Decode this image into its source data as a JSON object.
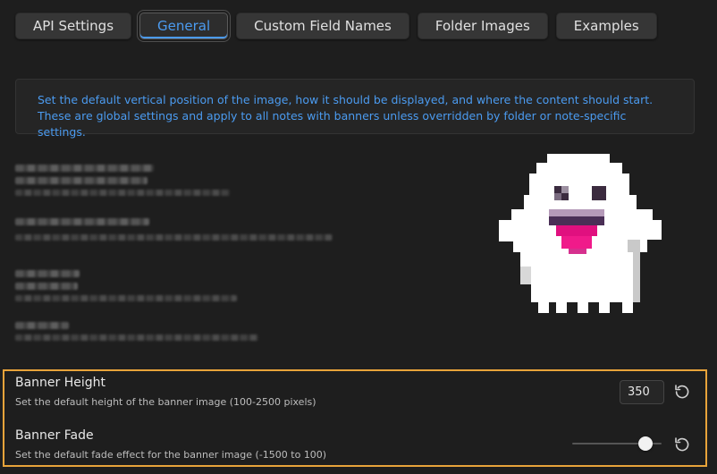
{
  "tabs": [
    {
      "label": "API Settings",
      "active": false
    },
    {
      "label": "General",
      "active": true
    },
    {
      "label": "Custom Field Names",
      "active": false
    },
    {
      "label": "Folder Images",
      "active": false
    },
    {
      "label": "Examples",
      "active": false
    }
  ],
  "info_text": "Set the default vertical position of the image, how it should be displayed, and where the content should start. These are global settings and apply to all notes with banners unless overridden by folder or note-specific settings.",
  "settings": {
    "banner_height": {
      "name": "Banner Height",
      "description": "Set the default height of the banner image (100-2500 pixels)",
      "value": "350"
    },
    "banner_fade": {
      "name": "Banner Fade",
      "description": "Set the default fade effect for the banner image (-1500 to 100)",
      "value": 100,
      "min": -1500,
      "max": 100
    }
  },
  "icons": {
    "reset": "reset-icon",
    "mascot": "ghost-icon"
  },
  "colors": {
    "accent": "#4b9bf0",
    "highlight": "#e8a33a",
    "background": "#1e1e1e"
  }
}
